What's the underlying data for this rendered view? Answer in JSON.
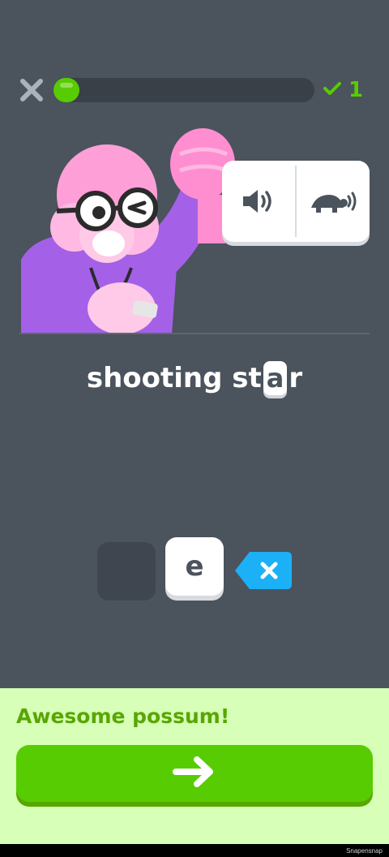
{
  "header": {
    "close_icon": "close-icon",
    "progress_fraction": 0.07,
    "streak_icon": "check-icon",
    "streak_count": "1",
    "accent_color": "#58cc02"
  },
  "audio": {
    "normal_icon": "speaker-icon",
    "slow_icon": "turtle-speaker-icon"
  },
  "prompt": {
    "prefix": "shooting st",
    "blank": "a",
    "suffix": "r"
  },
  "choices": {
    "option_letter": "e",
    "backspace_icon": "backspace-icon"
  },
  "footer": {
    "message": "Awesome possum!",
    "continue_icon": "arrow-right-icon",
    "bg_color": "#d7ffb8"
  },
  "watermark": "Snapensnap"
}
